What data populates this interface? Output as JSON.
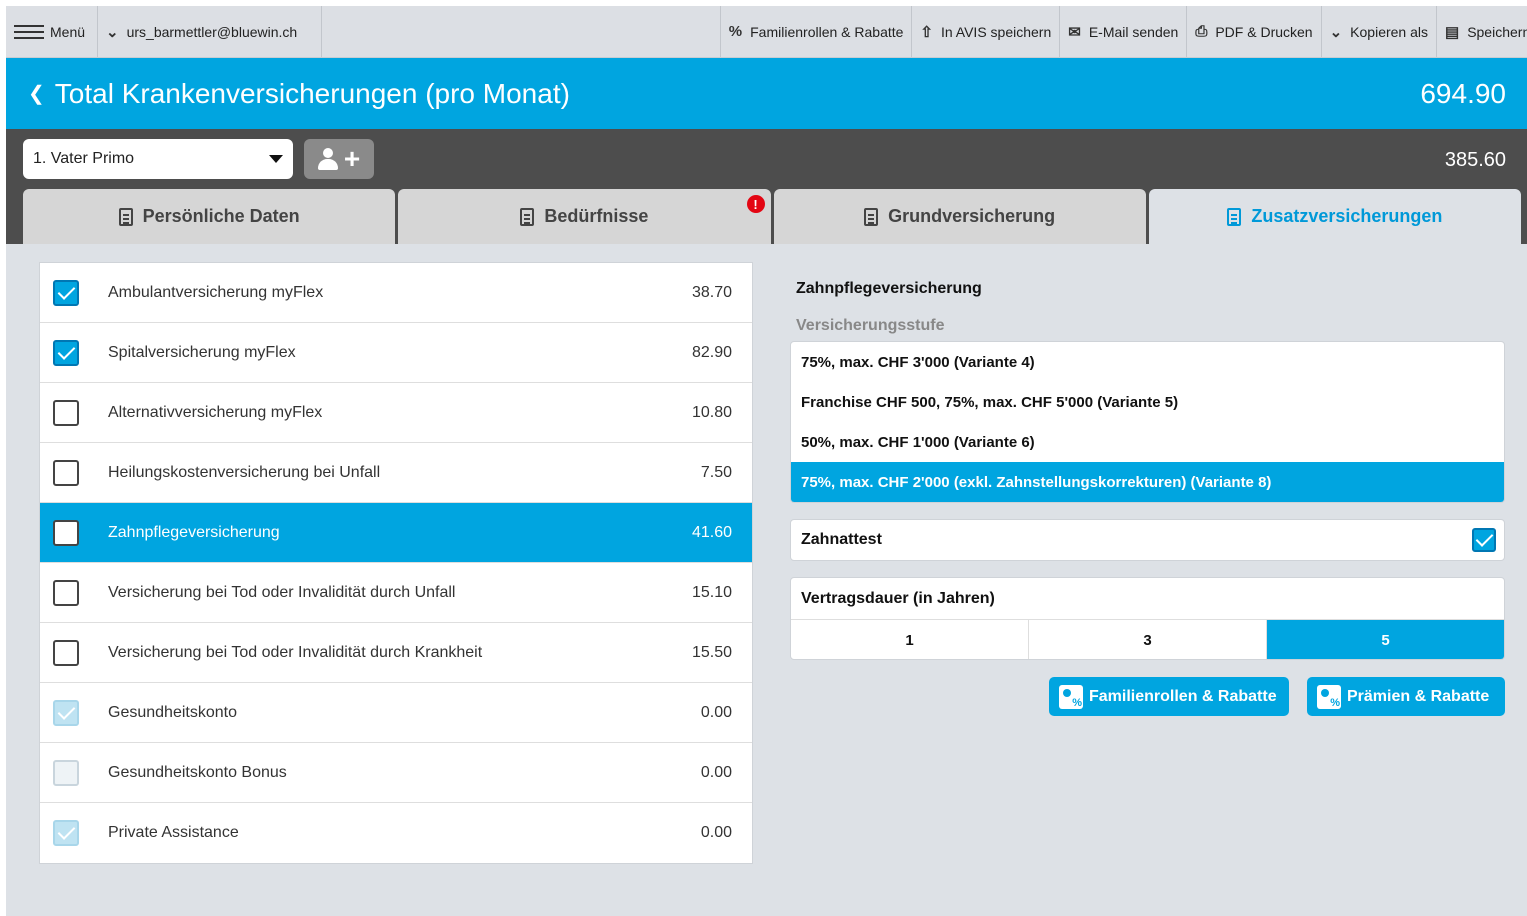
{
  "toolbar": {
    "menu_label": "Menü",
    "user_email": "urs_barmettler@bluewin.ch",
    "actions": [
      {
        "label": "Familienrollen & Rabatte",
        "icon": "percent-icon"
      },
      {
        "label": "In AVIS speichern",
        "icon": "upload-icon"
      },
      {
        "label": "E-Mail senden",
        "icon": "envelope-icon"
      },
      {
        "label": "PDF & Drucken",
        "icon": "printer-icon"
      },
      {
        "label": "Kopieren als",
        "icon": "chevron-down-icon"
      },
      {
        "label": "Speichern",
        "icon": "floppy-icon"
      }
    ]
  },
  "header": {
    "title": "Total Krankenversicherungen (pro Monat)",
    "total": "694.90"
  },
  "person": {
    "selected": "1. Vater Primo",
    "amount": "385.60"
  },
  "tabs": [
    {
      "label": "Persönliche Daten",
      "active": false,
      "alert": false
    },
    {
      "label": "Bedürfnisse",
      "active": false,
      "alert": true
    },
    {
      "label": "Grundversicherung",
      "active": false,
      "alert": false
    },
    {
      "label": "Zusatzversicherungen",
      "active": true,
      "alert": false
    }
  ],
  "alert_symbol": "!",
  "insurances": [
    {
      "label": "Ambulantversicherung myFlex",
      "amount": "38.70",
      "checked": true,
      "disabled": false,
      "selected": false
    },
    {
      "label": "Spitalversicherung myFlex",
      "amount": "82.90",
      "checked": true,
      "disabled": false,
      "selected": false
    },
    {
      "label": "Alternativversicherung myFlex",
      "amount": "10.80",
      "checked": false,
      "disabled": false,
      "selected": false
    },
    {
      "label": "Heilungskostenversicherung bei Unfall",
      "amount": "7.50",
      "checked": false,
      "disabled": false,
      "selected": false
    },
    {
      "label": "Zahnpflegeversicherung",
      "amount": "41.60",
      "checked": false,
      "disabled": false,
      "selected": true
    },
    {
      "label": "Versicherung bei Tod oder Invalidität durch Unfall",
      "amount": "15.10",
      "checked": false,
      "disabled": false,
      "selected": false
    },
    {
      "label": "Versicherung bei Tod oder Invalidität durch Krankheit",
      "amount": "15.50",
      "checked": false,
      "disabled": false,
      "selected": false
    },
    {
      "label": "Gesundheitskonto",
      "amount": "0.00",
      "checked": true,
      "disabled": true,
      "selected": false
    },
    {
      "label": "Gesundheitskonto Bonus",
      "amount": "0.00",
      "checked": false,
      "disabled": true,
      "selected": false
    },
    {
      "label": "Private Assistance",
      "amount": "0.00",
      "checked": true,
      "disabled": true,
      "selected": false
    }
  ],
  "detail": {
    "title": "Zahnpflegeversicherung",
    "level_label": "Versicherungsstufe",
    "levels": [
      {
        "label": "75%, max. CHF 3'000 (Variante 4)",
        "selected": false
      },
      {
        "label": "Franchise CHF 500, 75%, max. CHF 5'000 (Variante 5)",
        "selected": false
      },
      {
        "label": "50%, max. CHF 1'000 (Variante 6)",
        "selected": false
      },
      {
        "label": "75%, max. CHF 2'000 (exkl. Zahnstellungskorrekturen) (Variante 8)",
        "selected": true
      }
    ],
    "attest_label": "Zahnattest",
    "attest_checked": true,
    "duration_label": "Vertragsdauer (in Jahren)",
    "durations": [
      {
        "label": "1",
        "active": false
      },
      {
        "label": "3",
        "active": false
      },
      {
        "label": "5",
        "active": true
      }
    ],
    "button_family": "Familienrollen & Rabatte",
    "button_premium": "Prämien & Rabatte"
  },
  "colors": {
    "accent": "#00a5e0",
    "dark_bar": "#4d4d4d",
    "alert": "#e30613"
  }
}
